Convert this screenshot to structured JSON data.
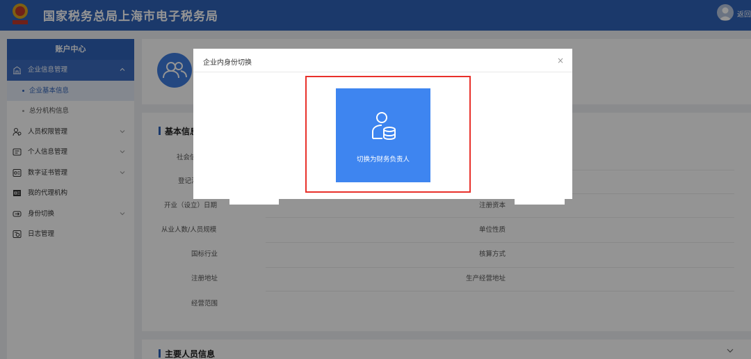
{
  "header": {
    "title": "国家税务总局上海市电子税务局",
    "back_label": "返回"
  },
  "sidebar": {
    "heading": "账户中心",
    "items": [
      {
        "label": "企业信息管理",
        "icon": "building-icon",
        "expanded": true
      },
      {
        "label": "企业基本信息",
        "sub": true,
        "selected": true
      },
      {
        "label": "总分机构信息",
        "sub": true
      },
      {
        "label": "人员权限管理",
        "icon": "people-permission-icon"
      },
      {
        "label": "个人信息管理",
        "icon": "id-card-icon"
      },
      {
        "label": "数字证书管理",
        "icon": "certificate-icon"
      },
      {
        "label": "我的代理机构",
        "icon": "agency-icon"
      },
      {
        "label": "身份切换",
        "icon": "switch-icon"
      },
      {
        "label": "日志管理",
        "icon": "log-icon"
      }
    ]
  },
  "main": {
    "section_basic": "基本信息",
    "fields_left": [
      "社会信",
      "登记注",
      "开业（设立）日期",
      "从业人数/人员规模",
      "国标行业",
      "注册地址",
      "经营范围"
    ],
    "fields_right": [
      "注册资本",
      "单位性质",
      "核算方式",
      "生产经营地址"
    ],
    "section_people": "主要人员信息"
  },
  "modal": {
    "title": "企业内身份切换",
    "close": "×",
    "option_label": "切换为财务负责人"
  },
  "colors": {
    "primary": "#2f62b8",
    "tile": "#3e85f0",
    "highlight": "#e8302a"
  }
}
